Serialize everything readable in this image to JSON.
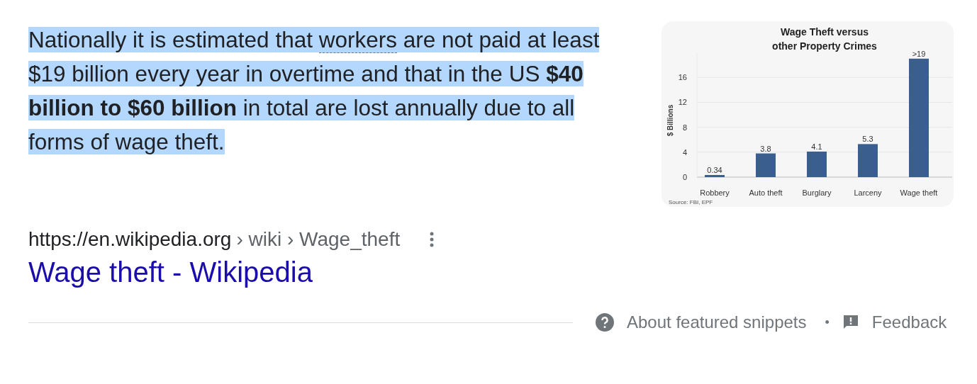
{
  "snippet": {
    "highlighted": true,
    "parts": [
      {
        "kind": "plain",
        "text": "Nationally it is estimated that "
      },
      {
        "kind": "term",
        "text": "workers"
      },
      {
        "kind": "plain",
        "text": " are not paid at least $19 billion every year in overtime and that in the US **$40 billion to $60 billion** in total are lost annually due to all forms of wage theft."
      }
    ]
  },
  "chart": {
    "chart_data": {
      "type": "bar",
      "title": "Wage Theft versus other Property Crimes",
      "ylabel": "$ Billions",
      "categories": [
        "Robbery",
        "Auto theft",
        "Burglary",
        "Larceny",
        "Wage theft"
      ],
      "series": [
        {
          "color": "#3a5f8f",
          "values": [
            0.34,
            3.8,
            4.1,
            5.3,
            19
          ]
        }
      ],
      "grid": true,
      "ylim": [
        0,
        20
      ],
      "yticks": [
        0,
        4,
        8,
        12,
        16
      ],
      "value_labels": [
        "0.34",
        "3.8",
        "4.1",
        "5.3",
        ">19"
      ]
    },
    "source": "Source: FBI, EPF"
  },
  "result": {
    "url": "https://en.wikipedia.org",
    "breadcrumbs": [
      "› wiki › Wage_theft"
    ],
    "title": "Wage theft - Wikipedia"
  },
  "footer": {
    "about": "About featured snippets",
    "separator": "•",
    "feedback": "Feedback"
  }
}
